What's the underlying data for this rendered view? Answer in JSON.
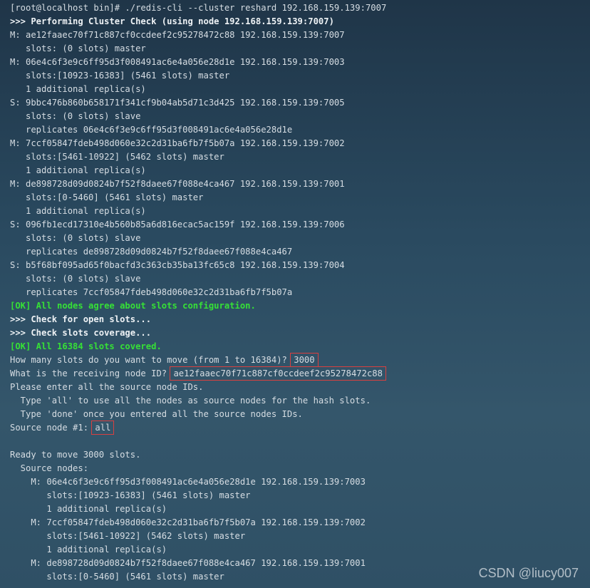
{
  "terminal": {
    "lines": [
      {
        "text": "[root@localhost bin]# ./redis-cli --cluster reshard 192.168.159.139:7007",
        "style": "normal"
      },
      {
        "text": ">>> Performing Cluster Check (using node 192.168.159.139:7007)",
        "style": "bold"
      },
      {
        "text": "M: ae12faaec70f71c887cf0ccdeef2c95278472c88 192.168.159.139:7007",
        "style": "normal"
      },
      {
        "text": "   slots: (0 slots) master",
        "style": "normal"
      },
      {
        "text": "M: 06e4c6f3e9c6ff95d3f008491ac6e4a056e28d1e 192.168.159.139:7003",
        "style": "normal"
      },
      {
        "text": "   slots:[10923-16383] (5461 slots) master",
        "style": "normal"
      },
      {
        "text": "   1 additional replica(s)",
        "style": "normal"
      },
      {
        "text": "S: 9bbc476b860b658171f341cf9b04ab5d71c3d425 192.168.159.139:7005",
        "style": "normal"
      },
      {
        "text": "   slots: (0 slots) slave",
        "style": "normal"
      },
      {
        "text": "   replicates 06e4c6f3e9c6ff95d3f008491ac6e4a056e28d1e",
        "style": "normal"
      },
      {
        "text": "M: 7ccf05847fdeb498d060e32c2d31ba6fb7f5b07a 192.168.159.139:7002",
        "style": "normal"
      },
      {
        "text": "   slots:[5461-10922] (5462 slots) master",
        "style": "normal"
      },
      {
        "text": "   1 additional replica(s)",
        "style": "normal"
      },
      {
        "text": "M: de898728d09d0824b7f52f8daee67f088e4ca467 192.168.159.139:7001",
        "style": "normal"
      },
      {
        "text": "   slots:[0-5460] (5461 slots) master",
        "style": "normal"
      },
      {
        "text": "   1 additional replica(s)",
        "style": "normal"
      },
      {
        "text": "S: 096fb1ecd17310e4b560b85a6d816ecac5ac159f 192.168.159.139:7006",
        "style": "normal"
      },
      {
        "text": "   slots: (0 slots) slave",
        "style": "normal"
      },
      {
        "text": "   replicates de898728d09d0824b7f52f8daee67f088e4ca467",
        "style": "normal"
      },
      {
        "text": "S: b5f68bf095ad65f0bacfd3c363cb35ba13fc65c8 192.168.159.139:7004",
        "style": "normal"
      },
      {
        "text": "   slots: (0 slots) slave",
        "style": "normal"
      },
      {
        "text": "   replicates 7ccf05847fdeb498d060e32c2d31ba6fb7f5b07a",
        "style": "normal"
      },
      {
        "text": "[OK] All nodes agree about slots configuration.",
        "style": "green"
      },
      {
        "text": ">>> Check for open slots...",
        "style": "bold"
      },
      {
        "text": ">>> Check slots coverage...",
        "style": "bold"
      },
      {
        "text": "[OK] All 16384 slots covered.",
        "style": "green"
      },
      {
        "text": "How many slots do you want to move (from 1 to 16384)? ",
        "style": "normal",
        "input": "3000"
      },
      {
        "text": "What is the receiving node ID? ",
        "style": "normal",
        "input": "ae12faaec70f71c887cf0ccdeef2c95278472c88"
      },
      {
        "text": "Please enter all the source node IDs.",
        "style": "normal"
      },
      {
        "text": "  Type 'all' to use all the nodes as source nodes for the hash slots.",
        "style": "normal"
      },
      {
        "text": "  Type 'done' once you entered all the source nodes IDs.",
        "style": "normal"
      },
      {
        "text": "Source node #1: ",
        "style": "normal",
        "input": "all"
      },
      {
        "text": "",
        "style": "normal"
      },
      {
        "text": "Ready to move 3000 slots.",
        "style": "normal"
      },
      {
        "text": "  Source nodes:",
        "style": "normal"
      },
      {
        "text": "    M: 06e4c6f3e9c6ff95d3f008491ac6e4a056e28d1e 192.168.159.139:7003",
        "style": "normal"
      },
      {
        "text": "       slots:[10923-16383] (5461 slots) master",
        "style": "normal"
      },
      {
        "text": "       1 additional replica(s)",
        "style": "normal"
      },
      {
        "text": "    M: 7ccf05847fdeb498d060e32c2d31ba6fb7f5b07a 192.168.159.139:7002",
        "style": "normal"
      },
      {
        "text": "       slots:[5461-10922] (5462 slots) master",
        "style": "normal"
      },
      {
        "text": "       1 additional replica(s)",
        "style": "normal"
      },
      {
        "text": "    M: de898728d09d0824b7f52f8daee67f088e4ca467 192.168.159.139:7001",
        "style": "normal"
      },
      {
        "text": "       slots:[0-5460] (5461 slots) master",
        "style": "normal"
      }
    ]
  },
  "watermark": "CSDN @liucy007",
  "colors": {
    "ok_green": "#36e036",
    "highlight_box": "#d94040",
    "text": "#d6dde3"
  }
}
